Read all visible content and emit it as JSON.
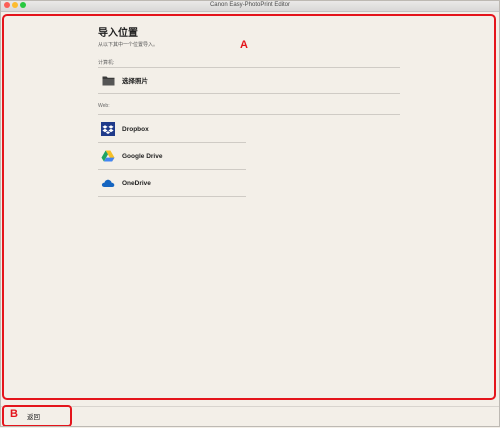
{
  "window": {
    "title": "Canon Easy-PhotoPrint Editor"
  },
  "annotations": {
    "a": "A",
    "b": "B"
  },
  "page": {
    "title": "导入位置",
    "subtitle": "从以下其中一个位置导入。"
  },
  "computer_section": {
    "label": "计算机:",
    "items": [
      {
        "label": "选择照片",
        "icon": "folder-icon"
      }
    ]
  },
  "web_section": {
    "label": "Web:",
    "items": [
      {
        "label": "Dropbox",
        "icon": "dropbox-icon"
      },
      {
        "label": "Google Drive",
        "icon": "google-drive-icon"
      },
      {
        "label": "OneDrive",
        "icon": "onedrive-icon"
      }
    ]
  },
  "footer": {
    "back_label": "返回"
  },
  "colors": {
    "annotation": "#e4141b",
    "background": "#f3efe8"
  }
}
